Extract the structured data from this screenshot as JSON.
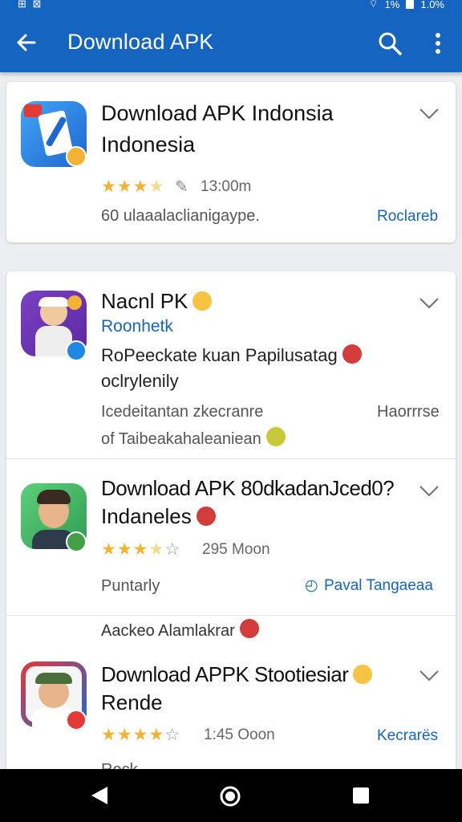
{
  "status": {
    "left_icons": "⊞ ⊠",
    "right_text": "1%",
    "right_text2": "1.0%"
  },
  "app_bar": {
    "title": "Download APK"
  },
  "items": [
    {
      "title_line1": "Download APK Indonsia",
      "title_line2": "Indonesia",
      "meta": "13:00m",
      "description": "60 ulaaalaclianigaype.",
      "action": "Roclareb"
    },
    {
      "title": "Nacnl PK",
      "subtitle": "Roonhetk",
      "body_line1": "RoPeeckate kuan Papilusatag",
      "body_line2": "oclrylenily",
      "grey_line1": "Icedeitantan zkecranre",
      "grey_right": "Haorrrse",
      "grey_line2": "of Taibeakahaleaniean"
    },
    {
      "title_line1": "Download APK 80dkadanJced0?",
      "title_line2": "Indaneles",
      "meta": "295 Moon",
      "left_label": "Puntarly",
      "action": "Paval Tangaeaa",
      "partial_text": "Aackeo Alamlakrar"
    },
    {
      "title_line1": "Download APPK Stootiesiar",
      "title_line2": "Rende",
      "meta": "1:45 Ooon",
      "action": "Kecrarës",
      "cut_text": "Rock"
    }
  ],
  "colors": {
    "primary": "#1565c0",
    "star": "#f2b233",
    "background": "#eceef1"
  }
}
